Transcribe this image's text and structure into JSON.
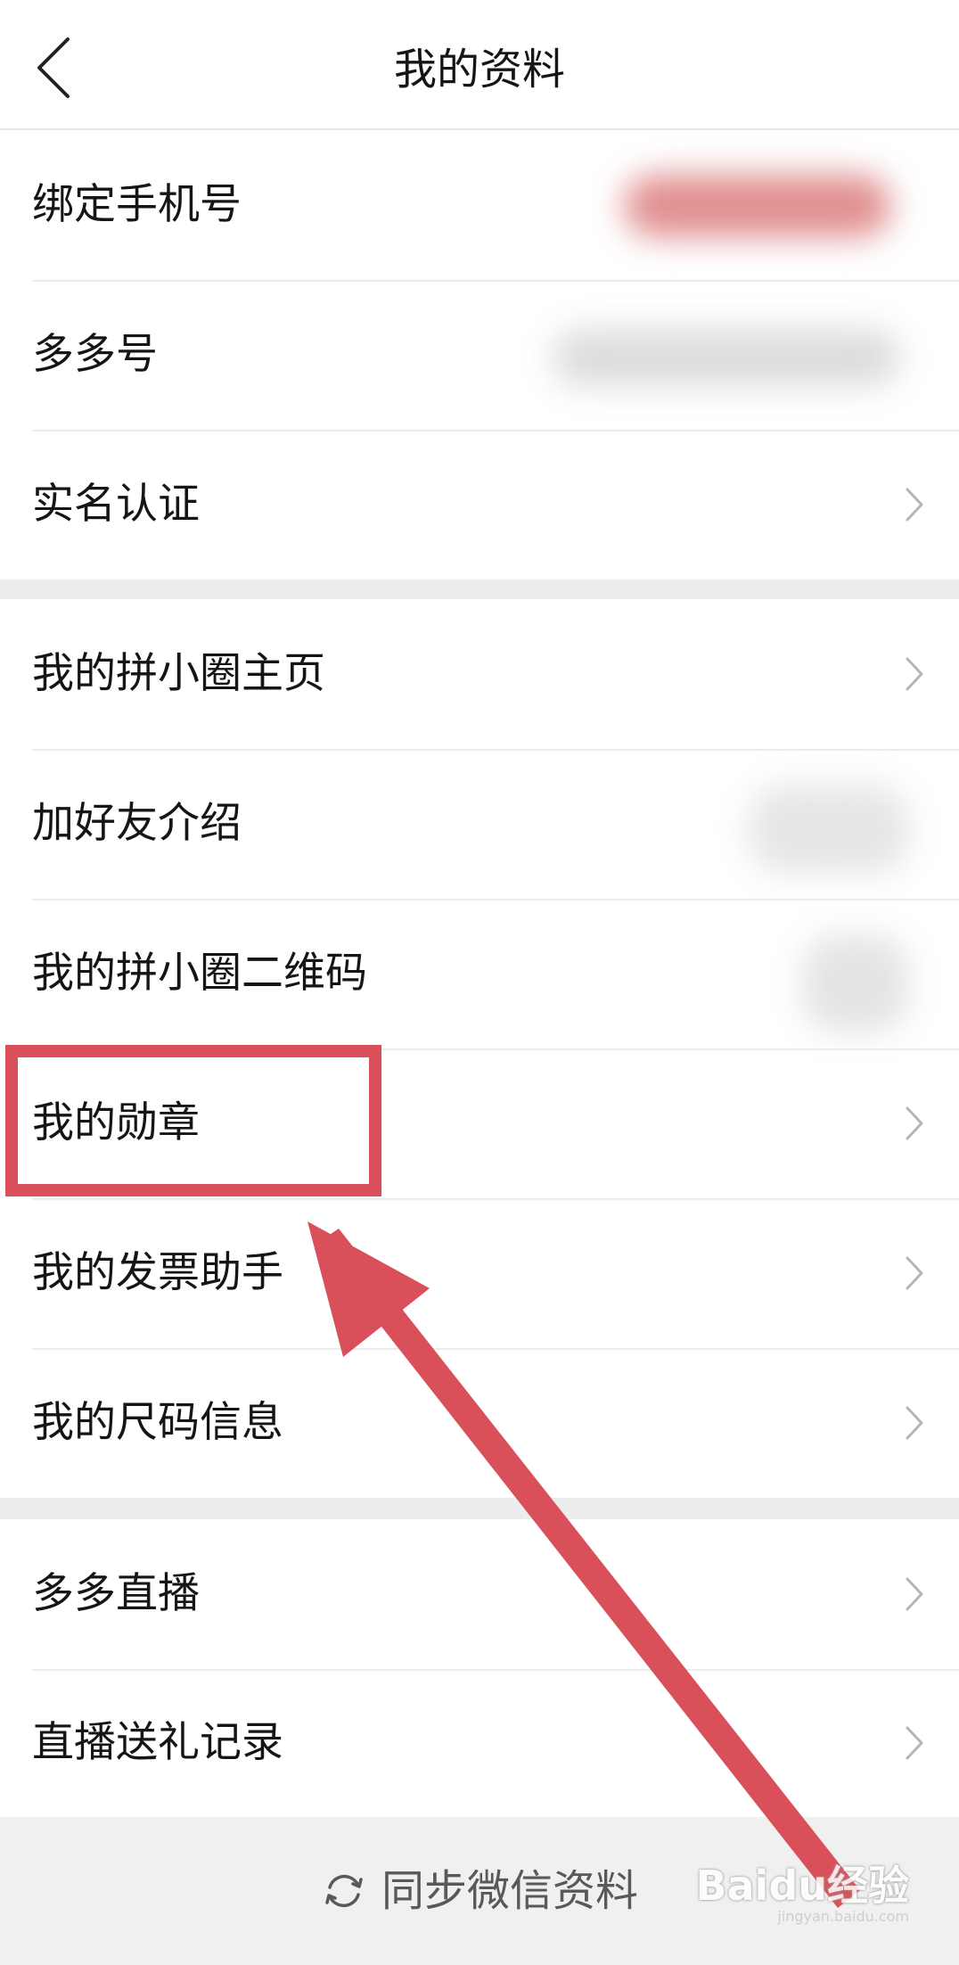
{
  "header": {
    "title": "我的资料"
  },
  "groups": [
    {
      "items": [
        {
          "label": "绑定手机号"
        },
        {
          "label": "多多号"
        },
        {
          "label": "实名认证"
        }
      ]
    },
    {
      "items": [
        {
          "label": "我的拼小圈主页"
        },
        {
          "label": "加好友介绍"
        },
        {
          "label": "我的拼小圈二维码"
        },
        {
          "label": "我的勋章"
        },
        {
          "label": "我的发票助手"
        },
        {
          "label": "我的尺码信息"
        }
      ]
    },
    {
      "items": [
        {
          "label": "多多直播"
        },
        {
          "label": "直播送礼记录"
        }
      ]
    }
  ],
  "bottom_bar": {
    "sync_label": "同步微信资料"
  },
  "watermark": {
    "main": "Baidu经验",
    "sub": "jingyan.baidu.com"
  },
  "colors": {
    "annotation_red": "#d9505a",
    "separator": "#ededed",
    "text": "#151516"
  },
  "icons": {
    "back": "chevron-left-icon",
    "row_arrow": "chevron-right-icon",
    "sync": "refresh-icon"
  }
}
